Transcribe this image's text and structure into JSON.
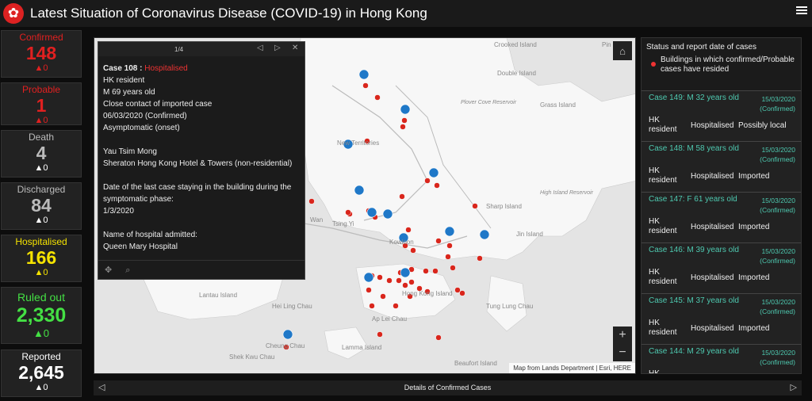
{
  "header": {
    "title": "Latest Situation of Coronavirus Disease (COVID-19) in Hong Kong"
  },
  "stats": [
    {
      "label": "Confirmed",
      "value": "148",
      "delta": "▲0",
      "color": "#e02020"
    },
    {
      "label": "Probable",
      "value": "1",
      "delta": "▲0",
      "color": "#e02020"
    },
    {
      "label": "Death",
      "value": "4",
      "delta": "▲0",
      "color": "#bbbbbb"
    },
    {
      "label": "Discharged",
      "value": "84",
      "delta": "▲0",
      "color": "#bbbbbb"
    },
    {
      "label": "Hospitalised",
      "value": "166",
      "delta": "▲0",
      "color": "#f5e300"
    },
    {
      "label": "Ruled out",
      "value": "2,330",
      "delta": "▲0",
      "color": "#44e044"
    },
    {
      "label": "Reported",
      "value": "2,645",
      "delta": "▲0",
      "color": "#ffffff"
    }
  ],
  "popup": {
    "pager": "1/4",
    "case_id": "Case 108 : ",
    "case_status": "Hospitalised",
    "lines": [
      "HK resident",
      "M 69 years old",
      "Close contact of imported case",
      "06/03/2020 (Confirmed)",
      "Asymptomatic (onset)"
    ],
    "district": "Yau Tsim Mong",
    "building": "Sheraton Hong Kong Hotel & Towers (non-residential)",
    "stay_label": "Date of the last case staying in the building during the symptomatic phase:",
    "stay_date": "1/3/2020",
    "hospital_label": "Name of hospital admitted:",
    "hospital": "Queen Mary Hospital"
  },
  "map": {
    "labels": [
      "Crooked Island",
      "Double Island",
      "Plover Cove Reservoir",
      "Grass Island",
      "New Territories",
      "High Island Reservoir",
      "Sharp Island",
      "Tsing Yi",
      "Wan",
      "Kowloon",
      "Jin Island",
      "Lantau Island",
      "Hei Ling Chau",
      "Hong Kong Island",
      "Tung Lung Chau",
      "Ap Lei Chau",
      "Cheung Chau",
      "Lamma Island",
      "Shek Kwu Chau",
      "Beaufort Island",
      "Pin"
    ],
    "attribution": "Map from Lands Department | Esri, HERE"
  },
  "sidebar": {
    "title": "Status and report date of  cases",
    "legend": "Buildings in which confirmed/Probable cases have resided",
    "cases": [
      {
        "name": "Case 149: M 32 years old",
        "date": "15/03/2020",
        "conf": "(Confirmed)",
        "resident": "HK resident",
        "status": "Hospitalised",
        "source": "Possibly local"
      },
      {
        "name": "Case 148: M 58 years old",
        "date": "15/03/2020",
        "conf": "(Confirmed)",
        "resident": "HK resident",
        "status": "Hospitalised",
        "source": "Imported"
      },
      {
        "name": "Case 147: F 61 years old",
        "date": "15/03/2020",
        "conf": "(Confirmed)",
        "resident": "HK resident",
        "status": "Hospitalised",
        "source": "Imported"
      },
      {
        "name": "Case 146: M 39 years old",
        "date": "15/03/2020",
        "conf": "(Confirmed)",
        "resident": "HK resident",
        "status": "Hospitalised",
        "source": "Imported"
      },
      {
        "name": "Case 145: M 37 years old",
        "date": "15/03/2020",
        "conf": "(Confirmed)",
        "resident": "HK resident",
        "status": "Hospitalised",
        "source": "Imported"
      },
      {
        "name": "Case 144: M 29 years old",
        "date": "15/03/2020",
        "conf": "(Confirmed)",
        "resident": "HK",
        "status": "",
        "source": ""
      }
    ]
  },
  "footer": {
    "title": "Details of Confirmed Cases"
  }
}
